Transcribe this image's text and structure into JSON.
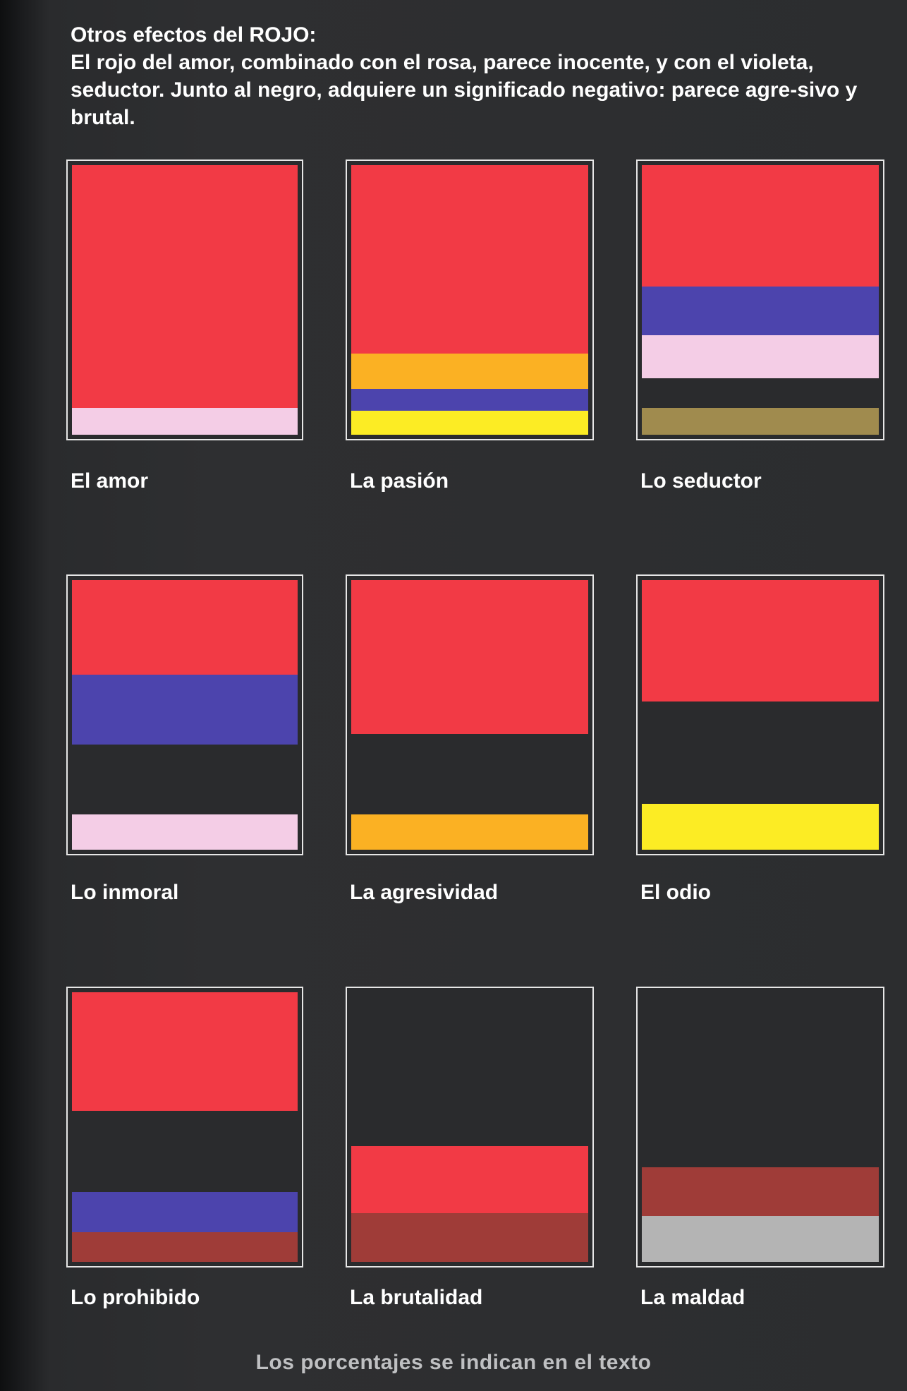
{
  "header": {
    "heading": "Otros efectos del ROJO:",
    "body": "El rojo del amor, combinado con el rosa, parece inocente, y con el violeta, seductor. Junto al negro, adquiere un significado negativo: parece agre-sivo y brutal."
  },
  "colors": {
    "red": "#f23a45",
    "pink": "#f4cde6",
    "orange": "#fbb123",
    "violet": "#4c44ad",
    "yellow": "#fcec24",
    "black": "#2a2b2d",
    "olive": "#a08b4e",
    "brown": "#9f3c38",
    "gray": "#b4b4b4"
  },
  "swatches": [
    {
      "label": "El amor",
      "bands": [
        {
          "color": "red",
          "share": 0.9
        },
        {
          "color": "pink",
          "share": 0.1
        }
      ]
    },
    {
      "label": "La pasión",
      "bands": [
        {
          "color": "red",
          "share": 0.7
        },
        {
          "color": "orange",
          "share": 0.13
        },
        {
          "color": "violet",
          "share": 0.08
        },
        {
          "color": "yellow",
          "share": 0.09
        }
      ]
    },
    {
      "label": "Lo seductor",
      "bands": [
        {
          "color": "red",
          "share": 0.45
        },
        {
          "color": "violet",
          "share": 0.18
        },
        {
          "color": "pink",
          "share": 0.16
        },
        {
          "color": "black",
          "share": 0.11
        },
        {
          "color": "olive",
          "share": 0.1
        }
      ]
    },
    {
      "label": "Lo inmoral",
      "bands": [
        {
          "color": "red",
          "share": 0.35
        },
        {
          "color": "violet",
          "share": 0.26
        },
        {
          "color": "black",
          "share": 0.26
        },
        {
          "color": "pink",
          "share": 0.13
        }
      ]
    },
    {
      "label": "La agresividad",
      "bands": [
        {
          "color": "red",
          "share": 0.57
        },
        {
          "color": "black",
          "share": 0.3
        },
        {
          "color": "orange",
          "share": 0.13
        }
      ]
    },
    {
      "label": "El odio",
      "bands": [
        {
          "color": "red",
          "share": 0.45
        },
        {
          "color": "black",
          "share": 0.38
        },
        {
          "color": "yellow",
          "share": 0.17
        }
      ]
    },
    {
      "label": "Lo prohibido",
      "bands": [
        {
          "color": "red",
          "share": 0.44
        },
        {
          "color": "black",
          "share": 0.3
        },
        {
          "color": "violet",
          "share": 0.15
        },
        {
          "color": "brown",
          "share": 0.11
        }
      ]
    },
    {
      "label": "La brutalidad",
      "bands": [
        {
          "color": "black",
          "share": 0.57
        },
        {
          "color": "red",
          "share": 0.25
        },
        {
          "color": "brown",
          "share": 0.18
        }
      ]
    },
    {
      "label": "La maldad",
      "bands": [
        {
          "color": "black",
          "share": 0.65
        },
        {
          "color": "brown",
          "share": 0.18
        },
        {
          "color": "gray",
          "share": 0.17
        }
      ]
    }
  ],
  "footer": "Los porcentajes se indican en el texto"
}
